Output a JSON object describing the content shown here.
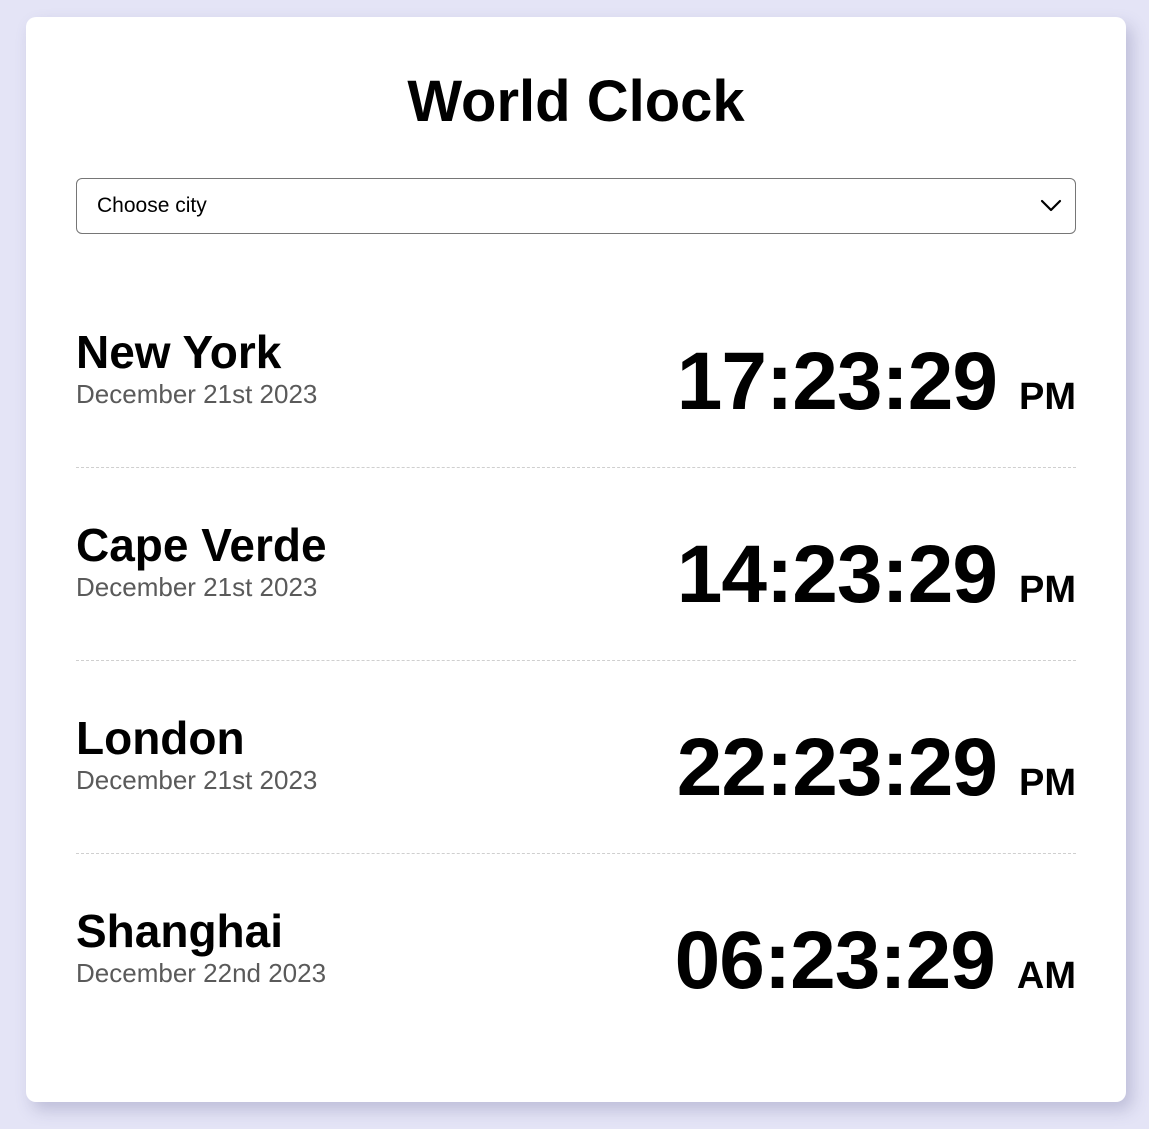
{
  "app": {
    "title": "World Clock"
  },
  "city_select": {
    "selected": "Choose city"
  },
  "cities": [
    {
      "name": "New York",
      "date": "December 21st 2023",
      "time": "17:23:29",
      "ampm": "PM"
    },
    {
      "name": "Cape Verde",
      "date": "December 21st 2023",
      "time": "14:23:29",
      "ampm": "PM"
    },
    {
      "name": "London",
      "date": "December 21st 2023",
      "time": "22:23:29",
      "ampm": "PM"
    },
    {
      "name": "Shanghai",
      "date": "December 22nd 2023",
      "time": "06:23:29",
      "ampm": "AM"
    }
  ],
  "colors": {
    "page_background": "#e4e4f6",
    "card_background": "#ffffff",
    "date_text": "#5a5a5a"
  },
  "icons": {
    "select_arrow": "chevron-down-icon"
  }
}
